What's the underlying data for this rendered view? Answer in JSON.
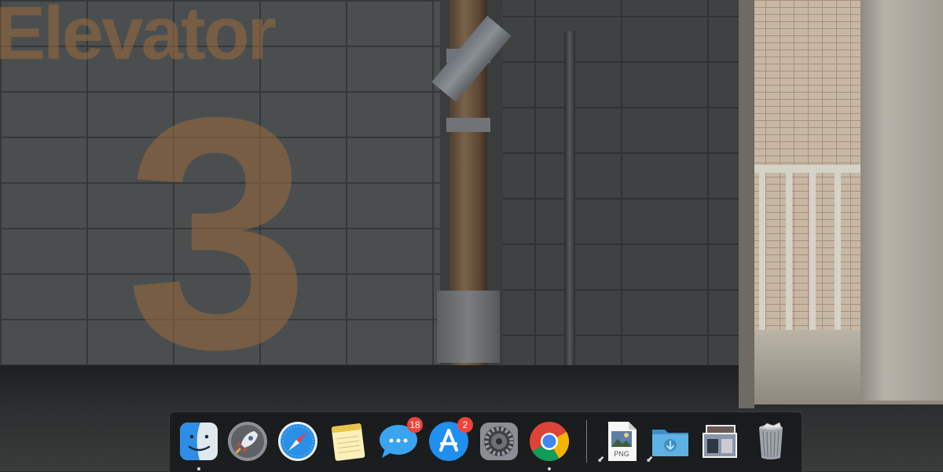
{
  "wallpaper": {
    "sign_word": "Elevator",
    "sign_number": "3"
  },
  "dock": {
    "apps": [
      {
        "name": "finder",
        "icon": "finder-icon",
        "running": true
      },
      {
        "name": "launchpad",
        "icon": "rocket-icon",
        "running": false
      },
      {
        "name": "safari",
        "icon": "compass-icon",
        "running": false
      },
      {
        "name": "notes",
        "icon": "notepad-icon",
        "running": false
      },
      {
        "name": "messages",
        "icon": "speech-bubble-icon",
        "badge": "18",
        "running": false
      },
      {
        "name": "app-store",
        "icon": "app-store-icon",
        "badge": "2",
        "running": false
      },
      {
        "name": "system-preferences",
        "icon": "gear-icon",
        "running": false
      },
      {
        "name": "chrome",
        "icon": "chrome-icon",
        "running": true
      }
    ],
    "files": [
      {
        "name": "png-file",
        "icon": "png-document-icon",
        "label": "PNG",
        "alias": true
      },
      {
        "name": "downloads-folder",
        "icon": "download-folder-icon",
        "alias": true
      },
      {
        "name": "photo-stack",
        "icon": "photo-stack-icon"
      },
      {
        "name": "trash",
        "icon": "trash-icon"
      }
    ]
  },
  "colors": {
    "sign": "#9a6a3c",
    "badge": "#f0433a",
    "dock_bg": "#16181a",
    "folder": "#4aa3d8"
  }
}
